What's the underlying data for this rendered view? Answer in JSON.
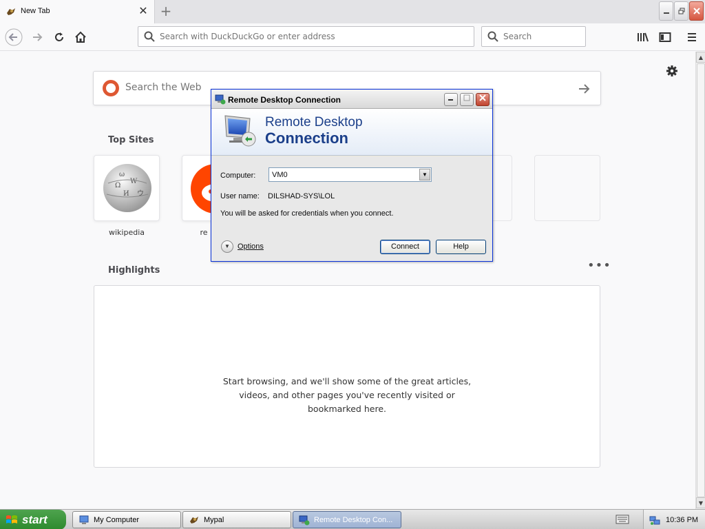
{
  "browser": {
    "tab": {
      "title": "New Tab",
      "close_glyph": "✕"
    },
    "new_tab_glyph": "+",
    "url_bar": {
      "placeholder": "Search with DuckDuckGo or enter address",
      "value": ""
    },
    "search_bar": {
      "placeholder": "Search",
      "value": ""
    }
  },
  "newtab": {
    "web_search_placeholder": "Search the Web",
    "top_sites_title": "Top Sites",
    "top_sites": [
      {
        "label": "wikipedia",
        "icon": "wikipedia-globe-icon"
      },
      {
        "label": "re",
        "icon": "reddit-icon"
      }
    ],
    "highlights_title": "Highlights",
    "highlights_menu": "•••",
    "highlights_message": [
      "Start browsing, and we'll show some of the great articles,",
      "videos, and other pages you've recently visited or",
      "bookmarked here."
    ]
  },
  "dialog": {
    "title": "Remote Desktop Connection",
    "banner_line1": "Remote Desktop",
    "banner_line2": "Connection",
    "computer_label": "Computer:",
    "computer_value": "VM0",
    "username_label": "User name:",
    "username_value": "DILSHAD-SYS\\LOL",
    "credentials_note": "You will be asked for credentials when you connect.",
    "options_label": "Options",
    "connect_label": "Connect",
    "help_label": "Help"
  },
  "taskbar": {
    "start_label": "start",
    "tasks": [
      {
        "label": "My Computer",
        "icon": "my-computer-icon",
        "active": false
      },
      {
        "label": "Mypal",
        "icon": "mypal-icon",
        "active": false
      },
      {
        "label": "Remote Desktop Con...",
        "icon": "remote-desktop-icon",
        "active": true
      }
    ],
    "clock": "10:36 PM"
  },
  "colors": {
    "accent_blue": "#1b3f8a",
    "xp_start_green": "#2d8a2d",
    "ddg_orange": "#de5833",
    "reddit_orange": "#ff4500"
  }
}
